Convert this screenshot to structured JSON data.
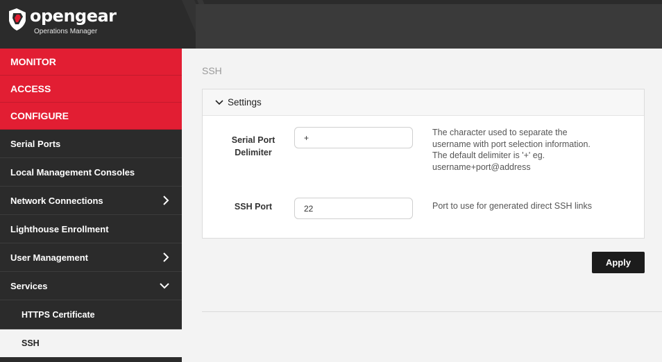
{
  "header": {
    "brand": "opengear",
    "product": "Operations Manager"
  },
  "sidebar": {
    "sections": [
      {
        "label": "MONITOR"
      },
      {
        "label": "ACCESS"
      },
      {
        "label": "CONFIGURE"
      }
    ],
    "items": [
      {
        "label": "Serial Ports"
      },
      {
        "label": "Local Management Consoles"
      },
      {
        "label": "Network Connections",
        "icon": "chevron-right-icon"
      },
      {
        "label": "Lighthouse Enrollment"
      },
      {
        "label": "User Management",
        "icon": "chevron-right-icon"
      },
      {
        "label": "Services",
        "icon": "chevron-down-icon"
      }
    ],
    "subitems": [
      {
        "label": "HTTPS Certificate"
      },
      {
        "label": "SSH"
      }
    ]
  },
  "main": {
    "title": "SSH",
    "panel_title": "Settings",
    "fields": {
      "delimiter_label_line1": "Serial Port",
      "delimiter_label_line2": "Delimiter",
      "delimiter_value": "+",
      "delimiter_help_1": "The character used to separate the",
      "delimiter_help_2": "username with port selection information.",
      "delimiter_help_3": "The default delimiter is '+' eg.",
      "delimiter_help_4": "username+port@address",
      "port_label": "SSH Port",
      "port_value": "22",
      "port_help": "Port to use for generated direct SSH links"
    },
    "apply_label": "Apply"
  },
  "colors": {
    "brand_red": "#e21e33",
    "sidebar_bg": "#2b2b2b",
    "header_bg": "#2b2b2b"
  }
}
